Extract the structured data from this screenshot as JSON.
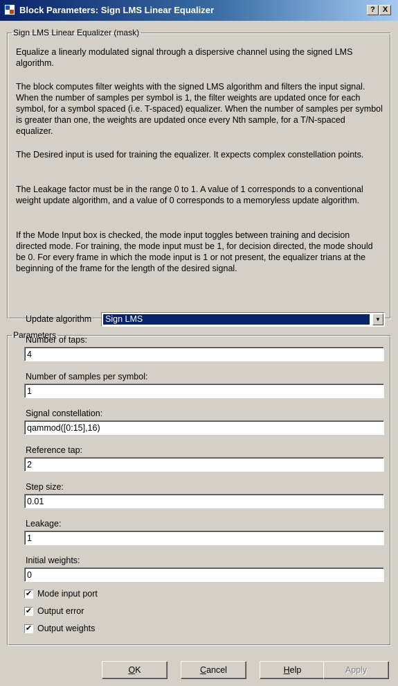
{
  "window": {
    "title": "Block Parameters: Sign LMS Linear  Equalizer",
    "help_label": "?",
    "close_label": "X"
  },
  "description": {
    "legend": "Sign LMS Linear Equalizer (mask)",
    "paragraphs": [
      "Equalize a linearly modulated signal through a dispersive channel using the signed LMS algorithm.",
      "The block computes filter weights with the signed LMS algorithm and filters the input signal. When the number of samples per symbol is 1, the filter weights are updated once for each symbol, for a symbol spaced (i.e. T-spaced) equalizer. When the number of samples per symbol is greater than one, the weights are updated once every Nth sample, for a T/N-spaced equalizer.",
      "The Desired input is used for training the equalizer. It expects complex constellation points.",
      "The Leakage factor must be in the range 0 to 1.  A value of 1 corresponds to a conventional weight update algorithm, and a value of 0 corresponds to a memoryless update algorithm.",
      "If the Mode Input box is checked, the mode input toggles between training and decision directed mode. For training, the mode input must be 1, for decision directed, the mode should be 0. For every frame in which the mode input is 1 or not present, the equalizer trians at the beginning of the frame for the length of the desired signal."
    ]
  },
  "parameters": {
    "legend": "Parameters",
    "update_algorithm": {
      "label": "Update algorithm",
      "value": "Sign LMS"
    },
    "fields": [
      {
        "label": "Number of taps:",
        "value": "4"
      },
      {
        "label": "Number of samples per symbol:",
        "value": "1"
      },
      {
        "label": "Signal constellation:",
        "value": "qammod([0:15],16)"
      },
      {
        "label": "Reference tap:",
        "value": "2"
      },
      {
        "label": "Step size:",
        "value": "0.01"
      },
      {
        "label": "Leakage:",
        "value": "1"
      },
      {
        "label": "Initial weights:",
        "value": "0"
      }
    ],
    "checkboxes": [
      {
        "label": "Mode input port",
        "checked": true
      },
      {
        "label": "Output error",
        "checked": true
      },
      {
        "label": "Output weights",
        "checked": true
      }
    ],
    "check_mark": "✔"
  },
  "buttons": {
    "ok": {
      "mnemonic": "O",
      "rest": "K"
    },
    "cancel": {
      "mnemonic": "C",
      "rest": "ancel"
    },
    "help": {
      "mnemonic": "H",
      "rest": "elp"
    },
    "apply": {
      "label": "Apply"
    }
  },
  "icons": {
    "select_arrow": "▼"
  }
}
